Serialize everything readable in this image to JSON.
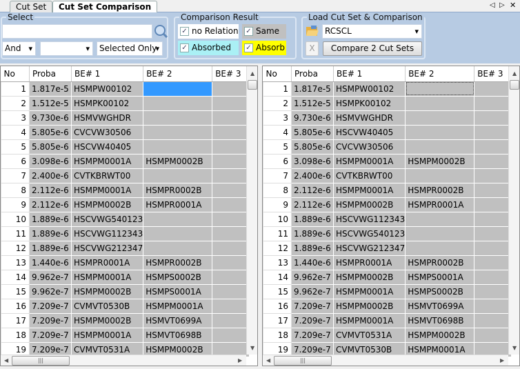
{
  "tabs": [
    {
      "label": "Cut Set"
    },
    {
      "label": "Cut Set Comparison"
    }
  ],
  "window_controls": {
    "prev": "◁",
    "next": "▷",
    "close": "✕"
  },
  "select": {
    "legend": "Select",
    "search_value": "",
    "search_icon": "magnifier-icon",
    "operator": "And",
    "field": "",
    "scope": "Selected Only"
  },
  "comparison": {
    "legend": "Comparison Result",
    "no_relation": {
      "label": "no Relation",
      "checked": true
    },
    "same": {
      "label": "Same",
      "checked": true,
      "color": "#c0c0c0"
    },
    "absorbed": {
      "label": "Absorbed",
      "checked": true,
      "color": "#aaf0f5"
    },
    "absorb": {
      "label": "Absorb",
      "checked": true,
      "color": "#ffff00"
    }
  },
  "load": {
    "legend": "Load Cut Set & Comparison",
    "folder_icon": "folder-open-icon",
    "selected": "RCSCL",
    "clear_label": "X",
    "compare_label": "Compare 2 Cut Sets"
  },
  "columns": [
    "No",
    "Proba",
    "BE# 1",
    "BE# 2",
    "BE# 3"
  ],
  "left_grid": {
    "selected_color": "#3399ff",
    "rows": [
      [
        "1",
        "1.817e-5",
        "HSMPW00102",
        "",
        ""
      ],
      [
        "2",
        "1.512e-5",
        "HSMPK00102",
        "",
        ""
      ],
      [
        "3",
        "9.730e-6",
        "HSMVWGHDR",
        "",
        ""
      ],
      [
        "4",
        "5.805e-6",
        "CVCVW30506",
        "",
        ""
      ],
      [
        "5",
        "5.805e-6",
        "HSCVW40405",
        "",
        ""
      ],
      [
        "6",
        "3.098e-6",
        "HSMPM0001A",
        "HSMPM0002B",
        ""
      ],
      [
        "7",
        "2.400e-6",
        "CVTKBRWT00",
        "",
        ""
      ],
      [
        "8",
        "2.112e-6",
        "HSMPM0001A",
        "HSMPR0002B",
        ""
      ],
      [
        "9",
        "2.112e-6",
        "HSMPM0002B",
        "HSMPR0001A",
        ""
      ],
      [
        "10",
        "1.889e-6",
        "HSCVWG540123",
        "",
        ""
      ],
      [
        "11",
        "1.889e-6",
        "HSCVWG112343",
        "",
        ""
      ],
      [
        "12",
        "1.889e-6",
        "HSCVWG212347",
        "",
        ""
      ],
      [
        "13",
        "1.440e-6",
        "HSMPR0001A",
        "HSMPR0002B",
        ""
      ],
      [
        "14",
        "9.962e-7",
        "HSMPM0001A",
        "HSMPS0002B",
        ""
      ],
      [
        "15",
        "9.962e-7",
        "HSMPM0002B",
        "HSMPS0001A",
        ""
      ],
      [
        "16",
        "7.209e-7",
        "CVMVT0530B",
        "HSMPM0001A",
        ""
      ],
      [
        "17",
        "7.209e-7",
        "HSMPM0002B",
        "HSMVT0699A",
        ""
      ],
      [
        "18",
        "7.209e-7",
        "HSMPM0001A",
        "HSMVT0698B",
        ""
      ],
      [
        "19",
        "7.209e-7",
        "CVMVT0531A",
        "HSMPM0002B",
        ""
      ]
    ]
  },
  "right_grid": {
    "rows": [
      [
        "1",
        "1.817e-5",
        "HSMPW00102",
        "",
        ""
      ],
      [
        "2",
        "1.512e-5",
        "HSMPK00102",
        "",
        ""
      ],
      [
        "3",
        "9.730e-6",
        "HSMVWGHDR",
        "",
        ""
      ],
      [
        "4",
        "5.805e-6",
        "HSCVW40405",
        "",
        ""
      ],
      [
        "5",
        "5.805e-6",
        "CVCVW30506",
        "",
        ""
      ],
      [
        "6",
        "3.098e-6",
        "HSMPM0001A",
        "HSMPM0002B",
        ""
      ],
      [
        "7",
        "2.400e-6",
        "CVTKBRWT00",
        "",
        ""
      ],
      [
        "8",
        "2.112e-6",
        "HSMPM0001A",
        "HSMPR0002B",
        ""
      ],
      [
        "9",
        "2.112e-6",
        "HSMPM0002B",
        "HSMPR0001A",
        ""
      ],
      [
        "10",
        "1.889e-6",
        "HSCVWG112343",
        "",
        ""
      ],
      [
        "11",
        "1.889e-6",
        "HSCVWG540123",
        "",
        ""
      ],
      [
        "12",
        "1.889e-6",
        "HSCVWG212347",
        "",
        ""
      ],
      [
        "13",
        "1.440e-6",
        "HSMPR0001A",
        "HSMPR0002B",
        ""
      ],
      [
        "14",
        "9.962e-7",
        "HSMPM0002B",
        "HSMPS0001A",
        ""
      ],
      [
        "15",
        "9.962e-7",
        "HSMPM0001A",
        "HSMPS0002B",
        ""
      ],
      [
        "16",
        "7.209e-7",
        "HSMPM0002B",
        "HSMVT0699A",
        ""
      ],
      [
        "17",
        "7.209e-7",
        "HSMPM0001A",
        "HSMVT0698B",
        ""
      ],
      [
        "18",
        "7.209e-7",
        "CVMVT0531A",
        "HSMPM0002B",
        ""
      ],
      [
        "19",
        "7.209e-7",
        "CVMVT0530B",
        "HSMPM0001A",
        ""
      ]
    ]
  }
}
